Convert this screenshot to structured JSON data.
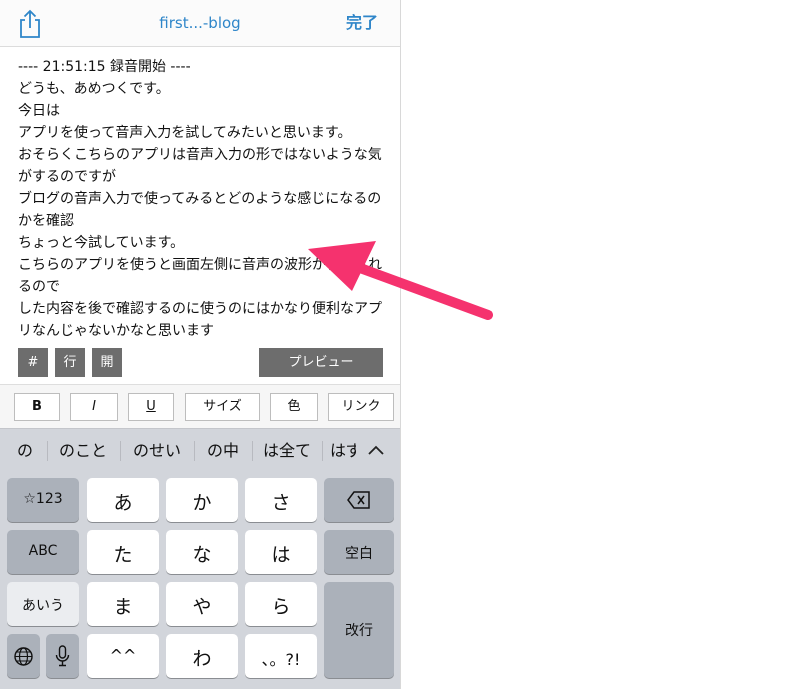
{
  "nav": {
    "title": "first...-blog",
    "done_label": "完了"
  },
  "editor": {
    "text": "---- 21:51:15 録音開始 ----\nどうも、あめつくです。\n今日は\nアプリを使って音声入力を試してみたいと思います。\nおそらくこちらのアプリは音声入力の形ではないような気がするのですが\nブログの音声入力で使ってみるとどのような感じになるのかを確認\nちょっと今試しています。\nこちらのアプリを使うと画面左側に音声の波形が表示されるので\nした内容を後で確認するのに使うのにはかなり便利なアプリなんじゃないかなと思います"
  },
  "mini_toolbar": {
    "hash": "#",
    "line": "行",
    "open": "開",
    "preview": "プレビュー"
  },
  "format_bar": {
    "bold": "B",
    "italic": "I",
    "underline": "U",
    "size": "サイズ",
    "color": "色",
    "link": "リンク"
  },
  "suggestions": [
    "の",
    "のこと",
    "のせい",
    "の中",
    "は全て",
    "はず"
  ],
  "keyboard": {
    "row1": {
      "mode": "☆123",
      "k1": "あ",
      "k2": "か",
      "k3": "さ"
    },
    "row2": {
      "mode": "ABC",
      "k1": "た",
      "k2": "な",
      "k3": "は",
      "space": "空白"
    },
    "row3": {
      "mode": "あいう",
      "k1": "ま",
      "k2": "や",
      "k3": "ら",
      "enter": "改行"
    },
    "row4": {
      "k1": "^^",
      "k2": "わ",
      "k3": "、。?!"
    }
  },
  "colors": {
    "accent": "#2f86c9",
    "toolbar_button": "#6d6d6d",
    "keyboard_bg": "#d2d5db",
    "dark_key": "#abb1ba",
    "arrow": "#f5326e"
  }
}
